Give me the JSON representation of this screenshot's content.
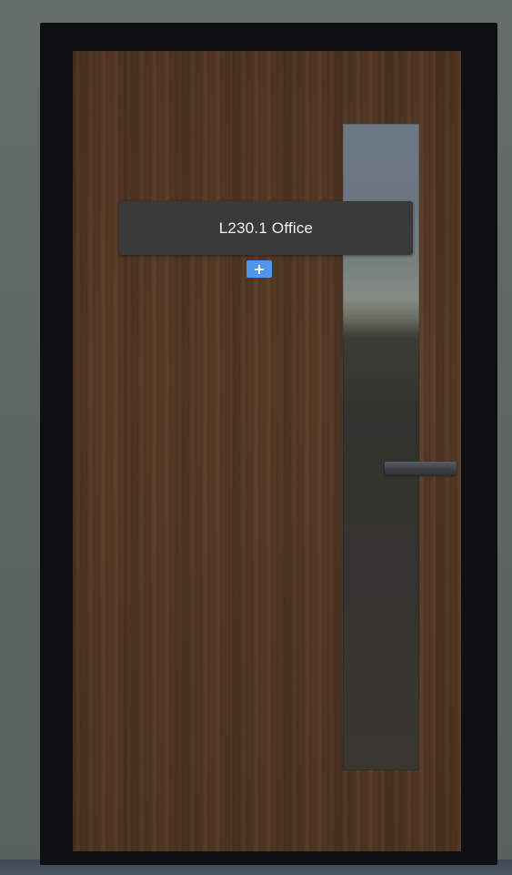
{
  "room_label": {
    "text": "L230.1 Office"
  },
  "add_button": {
    "icon": "plus-icon",
    "glyph": "+",
    "color": "#4f97e8"
  },
  "colors": {
    "wall": "#5f6862",
    "door_frame": "#0d0f10",
    "door_wood": "#553a26",
    "label_panel": "#3a3a3a"
  }
}
